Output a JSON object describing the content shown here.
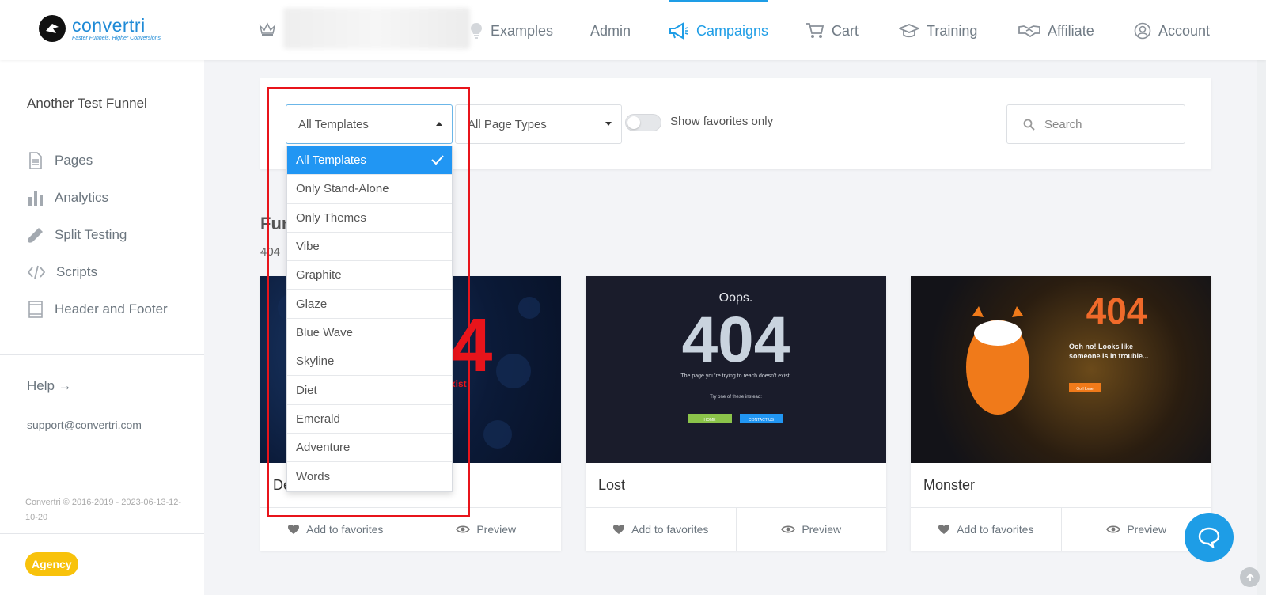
{
  "brand": {
    "name": "convertri",
    "tagline": "Faster Funnels, Higher Conversions"
  },
  "nav": {
    "items": [
      {
        "label": "Examples",
        "icon": "lightbulb-icon"
      },
      {
        "label": "Admin",
        "icon": ""
      },
      {
        "label": "Campaigns",
        "icon": "megaphone-icon",
        "active": true
      },
      {
        "label": "Cart",
        "icon": "cart-icon"
      },
      {
        "label": "Training",
        "icon": "graduation-cap-icon"
      },
      {
        "label": "Affiliate",
        "icon": "handshake-icon"
      },
      {
        "label": "Account",
        "icon": "user-circle-icon"
      }
    ],
    "accent_color": "#1e9de6"
  },
  "sidebar": {
    "funnel_name": "Another Test Funnel",
    "items": [
      {
        "label": "Pages",
        "icon": "page-icon"
      },
      {
        "label": "Analytics",
        "icon": "bar-chart-icon"
      },
      {
        "label": "Split Testing",
        "icon": "flask-icon"
      },
      {
        "label": "Scripts",
        "icon": "code-icon"
      },
      {
        "label": "Header and Footer",
        "icon": "layout-icon"
      }
    ],
    "help": "Help →",
    "support_email": "support@convertri.com",
    "copyright": "Convertri © 2016-2019 - 2023-06-13-12-10-20",
    "badge": "Agency",
    "badge_color": "#f8c20b"
  },
  "filters": {
    "template_select": "All Templates",
    "page_type_select": "All Page Types",
    "favorites_toggle_label": "Show favorites only",
    "favorites_only": false,
    "search_placeholder": "Search"
  },
  "dropdown": {
    "options": [
      "All Templates",
      "Only Stand-Alone",
      "Only Themes",
      "Vibe",
      "Graphite",
      "Glaze",
      "Blue Wave",
      "Skyline",
      "Diet",
      "Emerald",
      "Adventure",
      "Words"
    ],
    "selected": "All Templates"
  },
  "section": {
    "title_visible": "Fun",
    "subtitle_visible": "404"
  },
  "cards": [
    {
      "title": "De",
      "favorite_label": "Add to favorites",
      "preview_label": "Preview",
      "thumb": {
        "big": "4",
        "small": "xist"
      }
    },
    {
      "title": "Lost",
      "favorite_label": "Add to favorites",
      "preview_label": "Preview",
      "thumb": {
        "heading": "Oops.",
        "big": "404",
        "line1": "The page you're trying to reach doesn't exist.",
        "line2": "Try one of these instead:",
        "btn1": "HOME",
        "btn2": "CONTACT US"
      }
    },
    {
      "title": "Monster",
      "favorite_label": "Add to favorites",
      "preview_label": "Preview",
      "thumb": {
        "big": "404",
        "line1": "Ooh no! Looks like",
        "line2": "someone is in trouble...",
        "btn": "Go Home"
      }
    }
  ]
}
